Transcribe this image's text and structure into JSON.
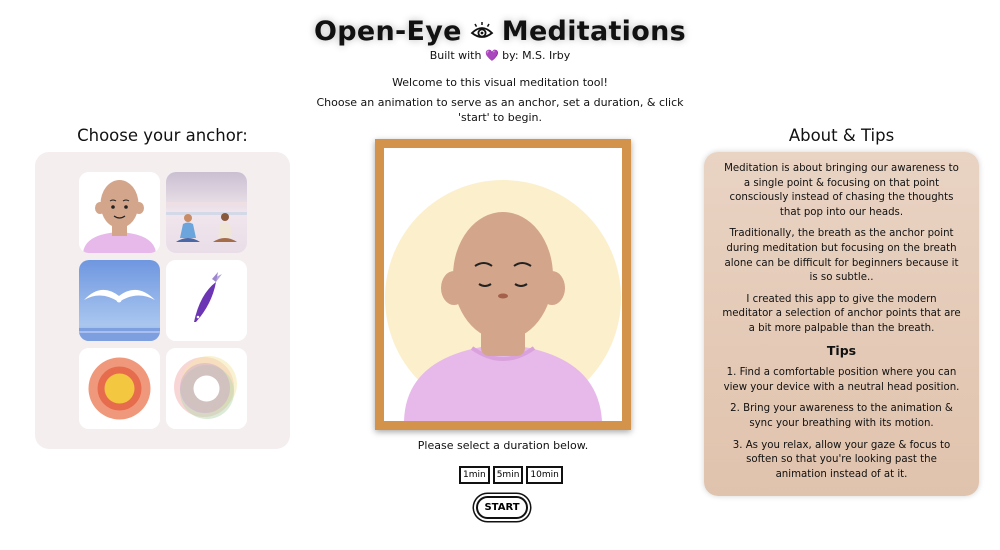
{
  "header": {
    "title_part1": "Open-Eye",
    "title_part2": "Meditations",
    "title_icon": "eye-icon",
    "byline_prefix": "Built with",
    "byline_heart": "💜",
    "byline_suffix": "by: M.S. Irby"
  },
  "welcome": {
    "line1": "Welcome to this visual meditation tool!",
    "line2": "Choose an animation to serve as an anchor, set a duration, & click 'start' to begin."
  },
  "anchor": {
    "heading": "Choose your anchor:",
    "options": [
      {
        "name": "meditating-face"
      },
      {
        "name": "meditating-pair"
      },
      {
        "name": "seagull-over-sea"
      },
      {
        "name": "purple-fish"
      },
      {
        "name": "concentric-circles"
      },
      {
        "name": "color-ring"
      }
    ]
  },
  "stage": {
    "duration_note": "Please select a duration below.",
    "durations": [
      "1min",
      "5min",
      "10min"
    ],
    "start_label": "START"
  },
  "about": {
    "heading": "About & Tips",
    "paragraphs": [
      "Meditation is about bringing our awareness to a single point & focusing on that point consciously instead of chasing the thoughts that pop into our heads.",
      "Traditionally, the breath as the anchor point during meditation but focusing on the breath alone can be difficult for beginners because it is so subtle..",
      "I created this app to give the modern meditator a selection of anchor points that are a bit more palpable than the breath."
    ],
    "tips_heading": "Tips",
    "tips": [
      "1. Find a comfortable position where you can view your device with a neutral head position.",
      "2. Bring your awareness to the animation & sync your breathing with its motion.",
      "3. As you relax, allow your gaze & focus to soften so that you're looking past the animation instead of at it."
    ]
  },
  "colors": {
    "frame": "#d4934a",
    "skin": "#d3a58a",
    "shirt": "#e7b9ea",
    "halo": "#fcefcc",
    "anchor_panel": "#f4eeef",
    "about_panel": "#e4cab6"
  }
}
